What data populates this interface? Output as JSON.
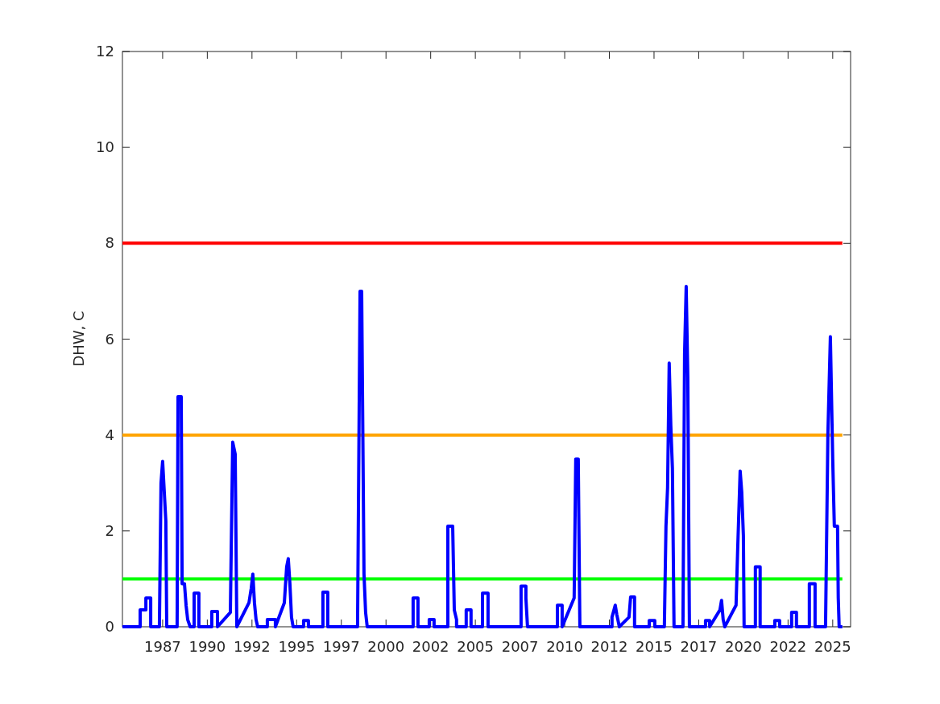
{
  "chart_data": {
    "type": "line",
    "ylabel": "DHW, C",
    "xlim": [
      1984.75,
      2025.5
    ],
    "ylim": [
      0,
      12
    ],
    "xticks": [
      {
        "value": 1987,
        "label": "1987"
      },
      {
        "value": 1989.5,
        "label": "1990"
      },
      {
        "value": 1992,
        "label": "1992"
      },
      {
        "value": 1994.5,
        "label": "1995"
      },
      {
        "value": 1997,
        "label": "1997"
      },
      {
        "value": 1999.5,
        "label": "2000"
      },
      {
        "value": 2002,
        "label": "2002"
      },
      {
        "value": 2004.5,
        "label": "2005"
      },
      {
        "value": 2007,
        "label": "2007"
      },
      {
        "value": 2009.5,
        "label": "2010"
      },
      {
        "value": 2012,
        "label": "2012"
      },
      {
        "value": 2014.5,
        "label": "2015"
      },
      {
        "value": 2017,
        "label": "2017"
      },
      {
        "value": 2019.5,
        "label": "2020"
      },
      {
        "value": 2022,
        "label": "2022"
      },
      {
        "value": 2024.5,
        "label": "2025"
      }
    ],
    "yticks": [
      0,
      2,
      4,
      6,
      8,
      10,
      12
    ],
    "x": [
      1984.75,
      1985.74,
      1985.74,
      1986.06,
      1986.06,
      1986.33,
      1986.33,
      1986.82,
      1986.91,
      1987.0,
      1987.18,
      1987.23,
      1987.81,
      1987.86,
      1988.04,
      1988.09,
      1988.22,
      1988.31,
      1988.4,
      1988.54,
      1988.76,
      1988.76,
      1989.03,
      1989.03,
      1989.75,
      1989.75,
      1990.07,
      1990.07,
      1990.79,
      1990.92,
      1991.06,
      1991.15,
      1991.83,
      1991.96,
      1992.05,
      1992.14,
      1992.23,
      1992.32,
      1992.86,
      1992.86,
      1993.31,
      1993.31,
      1993.81,
      1993.94,
      1994.03,
      1994.12,
      1994.21,
      1994.3,
      1994.89,
      1994.89,
      1995.16,
      1995.16,
      1995.97,
      1995.97,
      1996.24,
      1996.24,
      1997.91,
      1998.05,
      1998.14,
      1998.27,
      1998.36,
      1998.45,
      2001.02,
      2001.02,
      2001.29,
      2001.29,
      2001.92,
      2001.92,
      2002.19,
      2002.19,
      2002.96,
      2002.96,
      2003.23,
      2003.32,
      2003.45,
      2003.45,
      2003.99,
      2003.99,
      2004.26,
      2004.26,
      2004.9,
      2004.9,
      2005.21,
      2005.21,
      2007.06,
      2007.06,
      2007.33,
      2007.33,
      2007.42,
      2009.09,
      2009.09,
      2009.36,
      2009.36,
      2010.03,
      2010.12,
      2010.26,
      2010.35,
      2012.15,
      2012.15,
      2012.33,
      2012.42,
      2012.56,
      2013.1,
      2013.19,
      2013.41,
      2013.41,
      2014.23,
      2014.23,
      2014.54,
      2014.54,
      2015.08,
      2015.17,
      2015.26,
      2015.35,
      2015.44,
      2015.53,
      2015.62,
      2016.12,
      2016.21,
      2016.3,
      2016.39,
      2016.48,
      2017.38,
      2017.38,
      2017.61,
      2017.61,
      2018.19,
      2018.28,
      2018.37,
      2018.46,
      2019.09,
      2019.18,
      2019.32,
      2019.41,
      2019.5,
      2019.54,
      2020.17,
      2020.17,
      2020.44,
      2020.44,
      2021.26,
      2021.26,
      2021.53,
      2021.53,
      2022.2,
      2022.2,
      2022.47,
      2022.47,
      2023.19,
      2023.19,
      2023.51,
      2023.51,
      2024.1,
      2024.23,
      2024.37,
      2024.5,
      2024.59,
      2024.77,
      2024.81,
      2024.86,
      2025.04
    ],
    "series": [
      {
        "color": "#0000ff",
        "values": [
          0,
          0,
          0.35,
          0.35,
          0.6,
          0.6,
          0,
          0,
          3.0,
          3.45,
          2.2,
          0,
          0,
          4.8,
          4.8,
          0.9,
          0.9,
          0.45,
          0.15,
          0,
          0,
          0.7,
          0.7,
          0,
          0,
          0.32,
          0.32,
          0,
          0.3,
          3.85,
          3.6,
          0,
          0.5,
          0.8,
          1.1,
          0.5,
          0.15,
          0,
          0,
          0.15,
          0.15,
          0,
          0.5,
          1.25,
          1.42,
          0.9,
          0.2,
          0,
          0,
          0.13,
          0.13,
          0,
          0,
          0.72,
          0.72,
          0,
          0,
          7.0,
          7.0,
          1.1,
          0.3,
          0,
          0,
          0.6,
          0.6,
          0,
          0,
          0.15,
          0.15,
          0,
          0,
          2.1,
          2.1,
          0.35,
          0.15,
          0,
          0,
          0.35,
          0.35,
          0,
          0,
          0.7,
          0.7,
          0,
          0,
          0.85,
          0.85,
          0.6,
          0,
          0,
          0.45,
          0.45,
          0,
          0.6,
          3.5,
          3.5,
          0,
          0,
          0.2,
          0.45,
          0.25,
          0,
          0.2,
          0.62,
          0.62,
          0,
          0,
          0.13,
          0.13,
          0,
          0,
          2.1,
          2.9,
          5.5,
          4.2,
          3.3,
          0,
          0,
          5.7,
          7.1,
          5.2,
          0,
          0,
          0.13,
          0.13,
          0,
          0.35,
          0.55,
          0.15,
          0,
          0.45,
          1.6,
          3.25,
          2.8,
          1.9,
          0,
          0,
          1.25,
          1.25,
          0,
          0,
          0.13,
          0.13,
          0,
          0,
          0.3,
          0.3,
          0,
          0,
          0.9,
          0.9,
          0,
          0,
          4.0,
          6.05,
          3.5,
          2.1,
          2.1,
          0.6,
          0,
          0
        ]
      }
    ],
    "ref_lines": [
      {
        "axis": "y",
        "value": 8,
        "color": "#ff0000"
      },
      {
        "axis": "y",
        "value": 4,
        "color": "#ffa500"
      },
      {
        "axis": "y",
        "value": 1,
        "color": "#00ff00"
      }
    ]
  }
}
